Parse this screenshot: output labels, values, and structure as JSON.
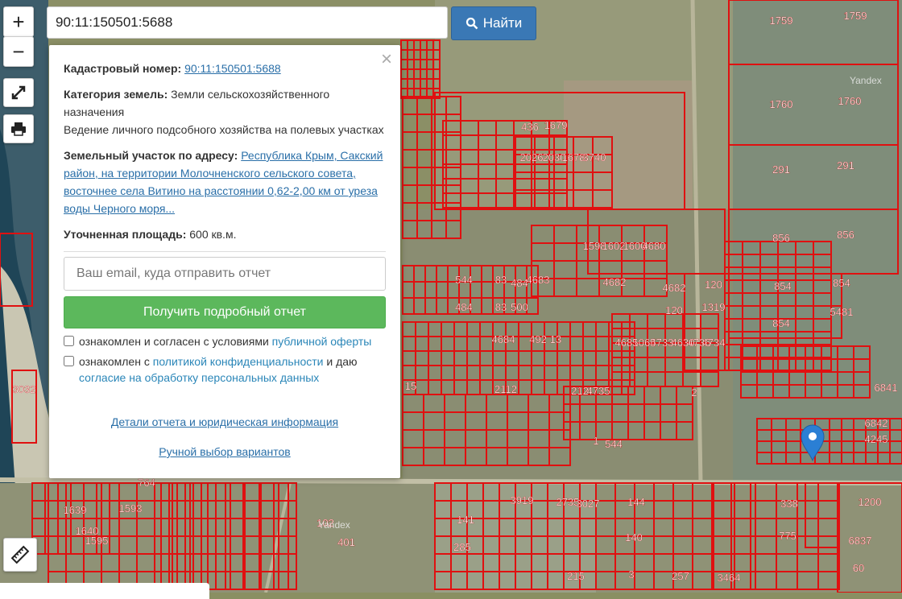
{
  "search": {
    "value": "90:11:150501:5688",
    "button_label": "Найти"
  },
  "controls": {
    "zoom_in": "+",
    "zoom_out": "−"
  },
  "popup": {
    "close": "×",
    "cadastral_label": "Кадастровый номер:",
    "cadastral_value": "90:11:150501:5688",
    "category_label": "Категория земель:",
    "category_value": "Земли сельскохозяйственного назначения",
    "category_use": "Ведение личного подсобного хозяйства на полевых участках",
    "address_label": "Земельный участок по адресу:",
    "address_value": "Республика Крым, Сакский район, на территории Молочненского сельского совета, восточнее села Витино на расстоянии 0,62-2,00 км от уреза воды Черного моря...",
    "area_label": "Уточненная площадь:",
    "area_value": "600 кв.м.",
    "email_placeholder": "Ваш email, куда отправить отчет",
    "report_button": "Получить подробный отчет",
    "check1_text": "ознакомлен и согласен с условиями ",
    "check1_link": "публичной оферты",
    "check2_text": "ознакомлен с ",
    "check2_link": "политикой конфиденциальности",
    "check2_mid": " и даю ",
    "check2_link2": "согласие на обработку персональных данных",
    "details_link": "Детали отчета и юридическая информация",
    "manual_link": "Ручной выбор вариантов"
  },
  "map": {
    "watermark": "Yandex",
    "parcel_color": "#e01010",
    "marker_color": "#2b7fd4",
    "labels": [
      "1759",
      "1759",
      "1760",
      "1760",
      "291",
      "291",
      "856",
      "856",
      "854",
      "854",
      "854",
      "5481",
      "6841",
      "6842",
      "4245",
      "436",
      "1679",
      "2026",
      "2030",
      "1678",
      "3740",
      "1598",
      "1602",
      "1600",
      "4680",
      "4682",
      "4682",
      "120",
      "120",
      "1319",
      "4734",
      "4736",
      "4630",
      "4733",
      "1065",
      "4685",
      "4735",
      "212",
      "2",
      "1",
      "544",
      "544",
      "484",
      "83",
      "484",
      "83",
      "500",
      "4683",
      "4684",
      "492",
      "13",
      "15",
      "2112",
      "3032",
      "3919",
      "2735",
      "3027",
      "144",
      "141",
      "285",
      "140",
      "3",
      "257",
      "3464",
      "215",
      "338",
      "775",
      "6837",
      "1200",
      "60",
      "102",
      "401",
      "1639",
      "1640",
      "1595",
      "1593",
      "764"
    ]
  }
}
